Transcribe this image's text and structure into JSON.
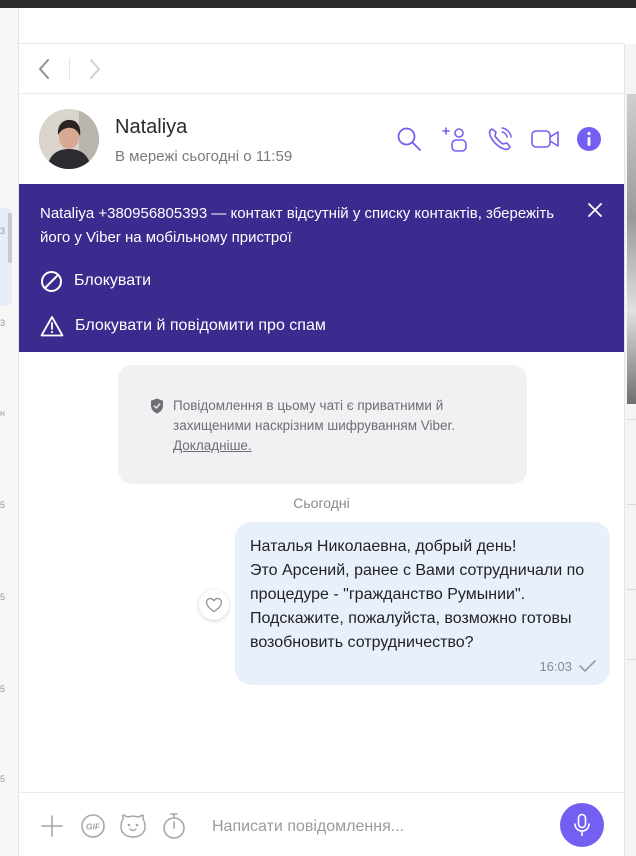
{
  "colors": {
    "accent": "#7360f2",
    "banner_bg": "#3b2b8e",
    "bubble_bg": "#e8f0fc",
    "encryption_bg": "#f1f1f3"
  },
  "left_panel": {
    "fragments": [
      "3",
      "3",
      "н",
      "5",
      "5",
      "5",
      "5"
    ]
  },
  "nav": {
    "back_icon": "chevron-left-icon",
    "forward_icon": "chevron-right-icon"
  },
  "contact": {
    "name": "Nataliya",
    "status": "В мережі сьогодні о 11:59"
  },
  "header_icons": [
    "search-icon",
    "add-participant-icon",
    "call-icon",
    "video-call-icon",
    "info-icon"
  ],
  "banner": {
    "text": "Nataliya +380956805393 — контакт відсутній у списку контактів, збережіть його у Viber на мобільному пристрої",
    "block_label": "Блокувати",
    "block_report_label": "Блокувати й повідомити про спам"
  },
  "encryption": {
    "text": "Повідомлення в цьому чаті є приватними й захищеними наскрізним шифруванням Viber.",
    "link": "Докладніше."
  },
  "date_label": "Сьогодні",
  "message": {
    "text": "Наталья Николаевна, добрый день!\nЭто Арсений, ранее с Вами сотрудничали по процедуре - \"гражданство Румынии\". Подскажите, пожалуйста, возможно готовы возобновить сотрудничество?",
    "time": "16:03"
  },
  "composer": {
    "placeholder": "Написати повідомлення..."
  }
}
